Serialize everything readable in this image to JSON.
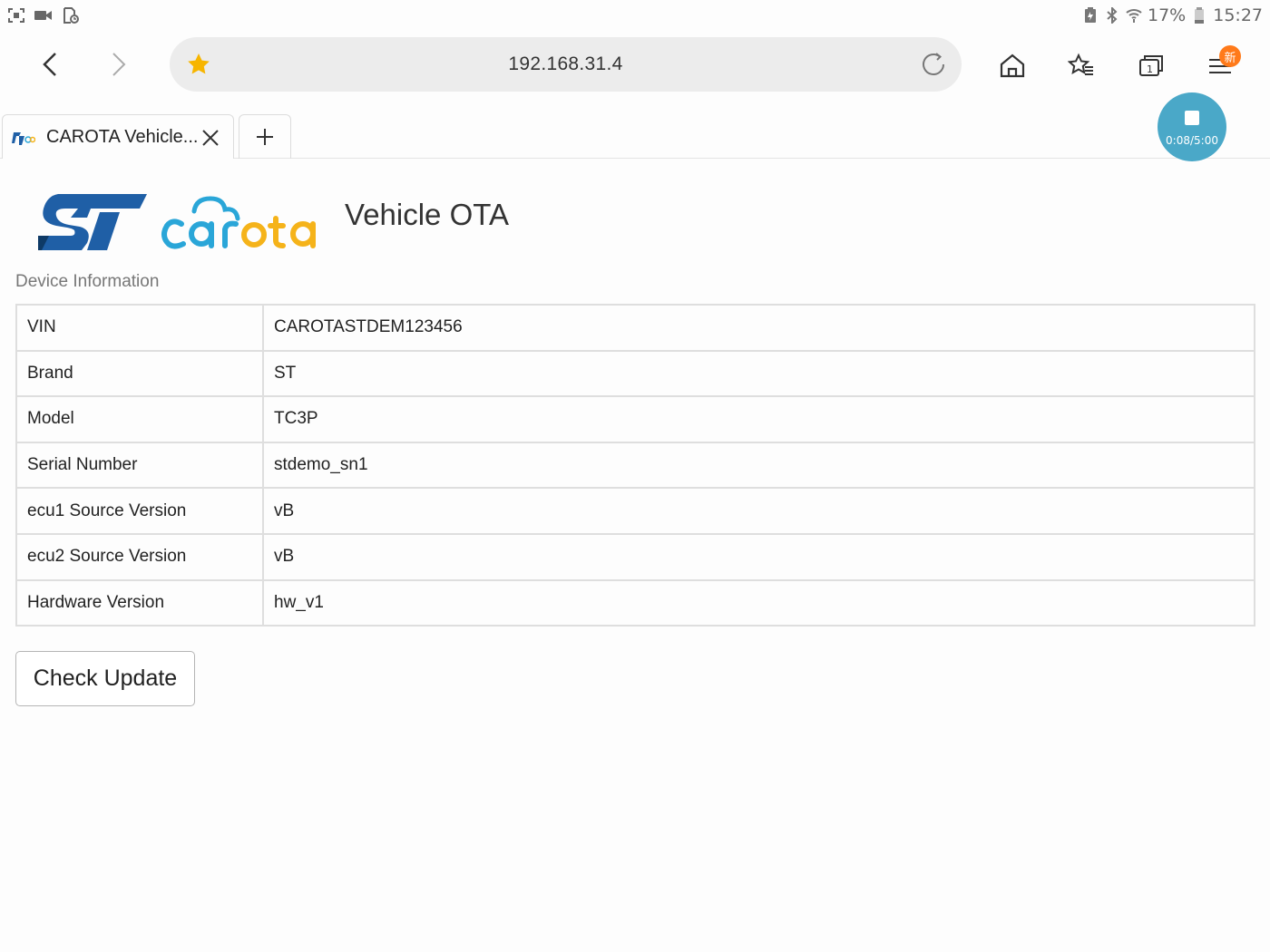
{
  "status_bar": {
    "battery_percent": "17%",
    "time": "15:27",
    "icons": [
      "screenshot-icon",
      "video-icon",
      "file-clock-icon",
      "battery-saver-icon",
      "bluetooth-icon",
      "wifi-icon",
      "battery-icon"
    ]
  },
  "browser": {
    "url": "192.168.31.4",
    "new_badge": "新",
    "tab": {
      "title": "CAROTA Vehicle..."
    }
  },
  "recording": {
    "elapsed": "0:08/5:00"
  },
  "page": {
    "title": "Vehicle OTA",
    "section_label": "Device Information",
    "rows": [
      {
        "key": "VIN",
        "value": "CAROTASTDEM123456"
      },
      {
        "key": "Brand",
        "value": "ST"
      },
      {
        "key": "Model",
        "value": "TC3P"
      },
      {
        "key": "Serial Number",
        "value": "stdemo_sn1"
      },
      {
        "key": "ecu1 Source Version",
        "value": "vB"
      },
      {
        "key": "ecu2 Source Version",
        "value": "vB"
      },
      {
        "key": "Hardware Version",
        "value": "hw_v1"
      }
    ],
    "check_button": "Check Update",
    "logo_text": "carota"
  },
  "colors": {
    "st_blue": "#1f5fa6",
    "carota_blue": "#2aa6d8",
    "carota_yellow": "#f5b31a",
    "recording_bubble": "#4aa8c8",
    "badge_orange": "#ff7a1a",
    "star_yellow": "#f7b500"
  }
}
